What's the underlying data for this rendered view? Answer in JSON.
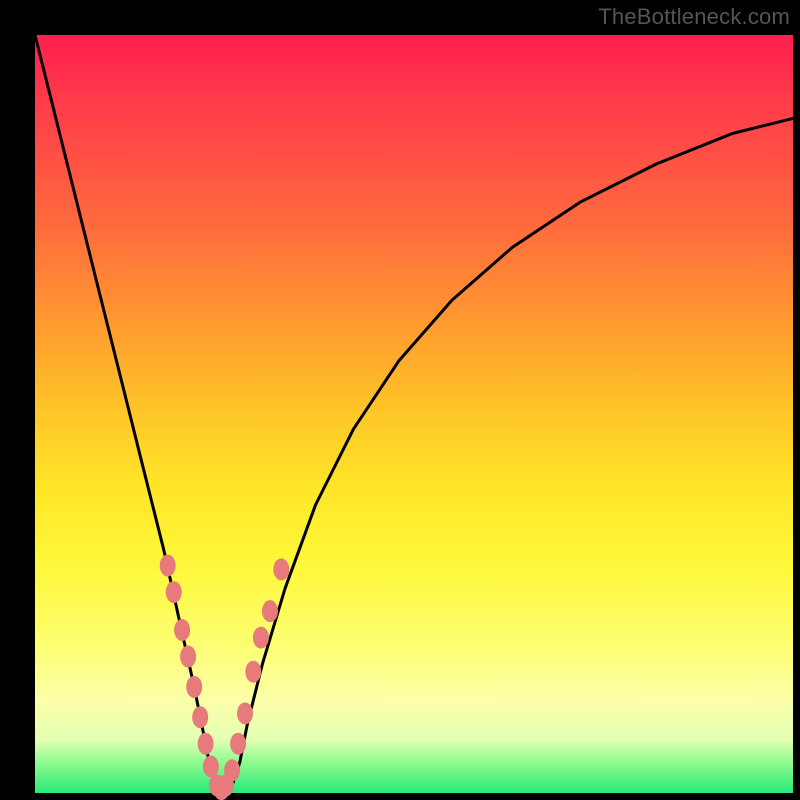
{
  "watermark": "TheBottleneck.com",
  "colors": {
    "frame": "#000000",
    "curve": "#000000",
    "dot": "#e77a7a"
  },
  "chart_data": {
    "type": "line",
    "title": "",
    "xlabel": "",
    "ylabel": "",
    "xlim": [
      0,
      100
    ],
    "ylim": [
      0,
      100
    ],
    "note": "Axes unlabeled; values approximated from pixel positions. y=0 is bottom (green / optimum), y=100 is top. Curve has a sharp V-shaped minimum near x≈24.",
    "series": [
      {
        "name": "bottleneck-curve",
        "x": [
          0,
          2,
          5,
          8,
          11,
          14,
          17,
          19,
          21,
          22,
          23,
          24,
          25,
          26,
          27,
          28,
          30,
          33,
          37,
          42,
          48,
          55,
          63,
          72,
          82,
          92,
          100
        ],
        "y": [
          100,
          92,
          80,
          68,
          56,
          44,
          32,
          23,
          14,
          9,
          4,
          1,
          0,
          1,
          4,
          9,
          17,
          27,
          38,
          48,
          57,
          65,
          72,
          78,
          83,
          87,
          89
        ]
      }
    ],
    "markers": {
      "name": "highlighted-points",
      "comment": "Pink capsule/dot clusters along both branches near the minimum.",
      "x": [
        17.5,
        18.3,
        19.4,
        20.2,
        21.0,
        21.8,
        22.5,
        23.2,
        24.0,
        24.6,
        25.2,
        26.0,
        26.8,
        27.7,
        28.8,
        29.8,
        31.0,
        32.5
      ],
      "y": [
        30.0,
        26.5,
        21.5,
        18.0,
        14.0,
        10.0,
        6.5,
        3.5,
        1.0,
        0.5,
        1.0,
        3.0,
        6.5,
        10.5,
        16.0,
        20.5,
        24.0,
        29.5
      ]
    }
  }
}
